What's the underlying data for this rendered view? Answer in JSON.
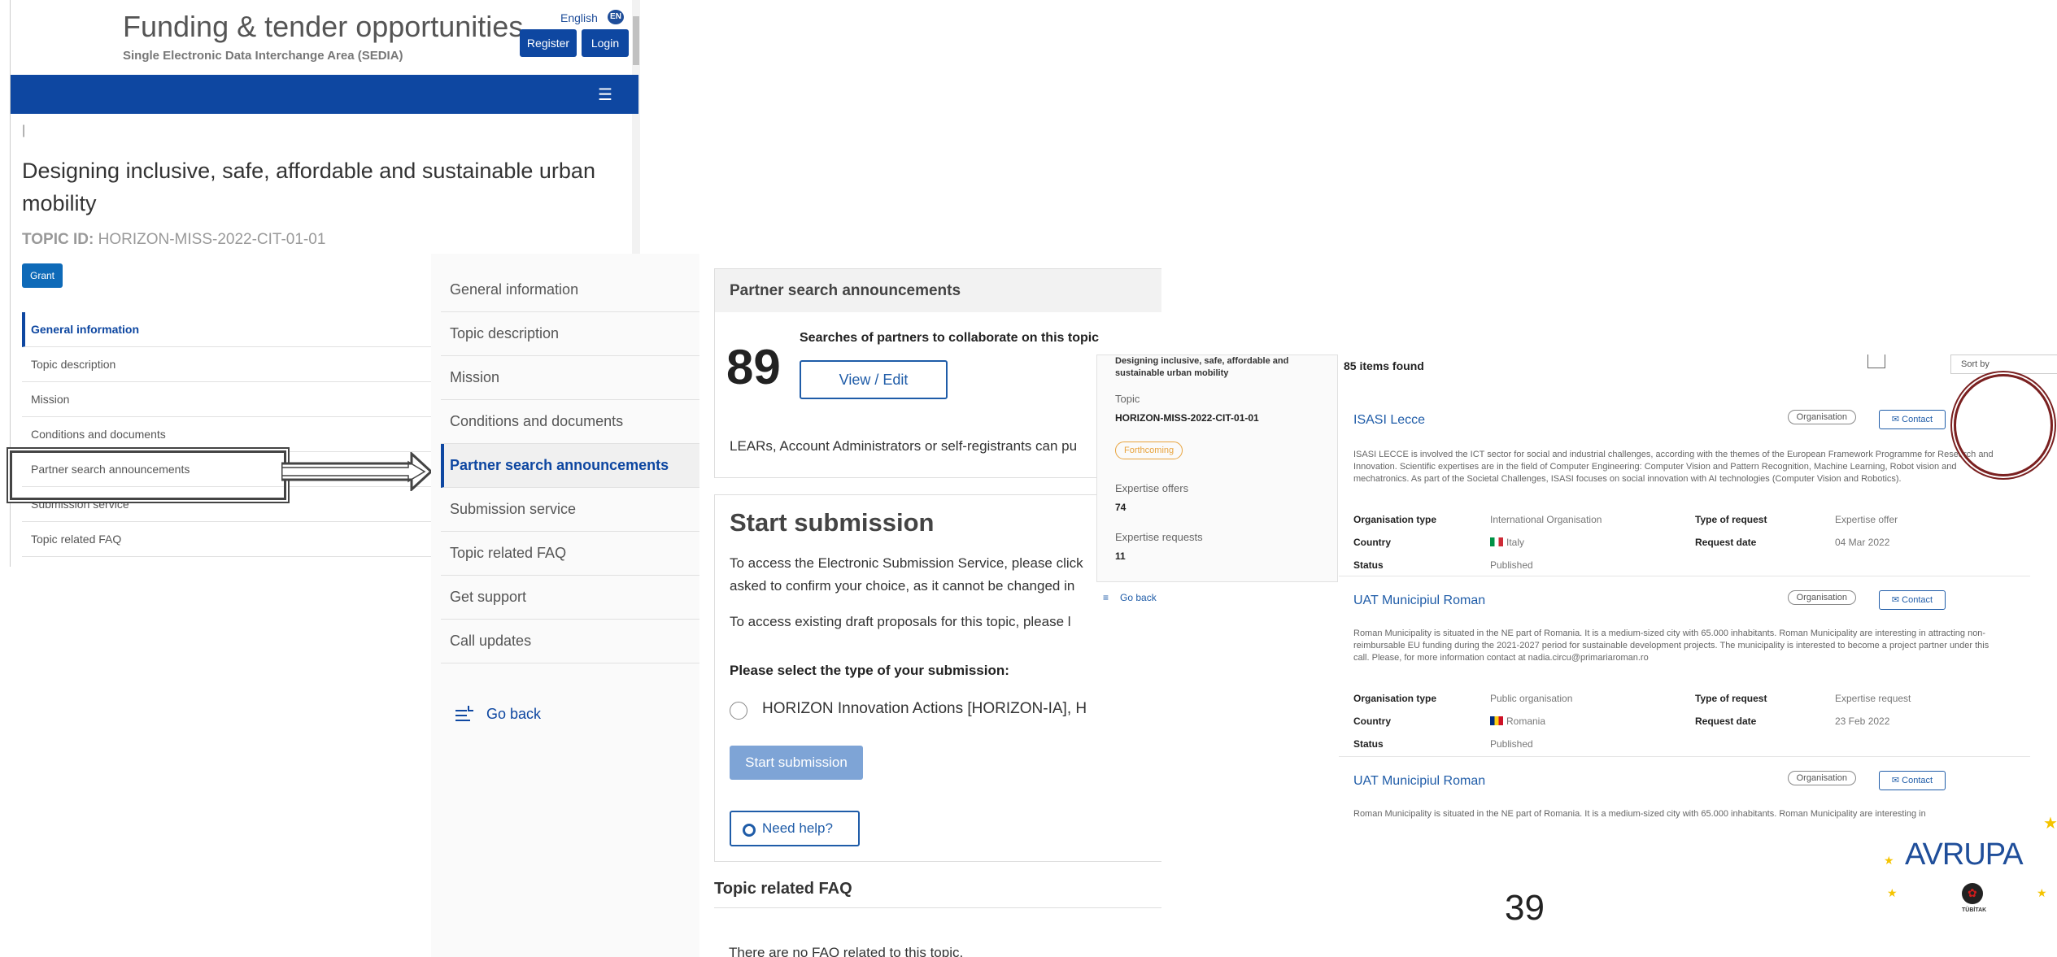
{
  "panel1": {
    "site_title": "Funding & tender opportunities",
    "site_subtitle": "Single Electronic Data Interchange Area (SEDIA)",
    "language": "English",
    "language_code": "EN",
    "register_label": "Register",
    "login_label": "Login",
    "menu_icon": "☰",
    "cursor_mark": "|",
    "topic_title": "Designing inclusive, safe, affordable and sustainable urban mobility",
    "topic_id_label": "TOPIC ID:",
    "topic_id": "HORIZON-MISS-2022-CIT-01-01",
    "grant_badge": "Grant",
    "nav": [
      "General information",
      "Topic description",
      "Mission",
      "Conditions and documents",
      "Partner search announcements",
      "Submission service",
      "Topic related FAQ"
    ]
  },
  "panel2": {
    "nav": [
      "General information",
      "Topic description",
      "Mission",
      "Conditions and documents",
      "Partner search announcements",
      "Submission service",
      "Topic related FAQ",
      "Get support",
      "Call updates"
    ],
    "go_back": "Go back",
    "partner_header": "Partner search announcements",
    "partner_count": "89",
    "partner_caption": "Searches of partners to collaborate on this topic",
    "view_edit": "View / Edit",
    "lears_text": "LEARs, Account Administrators or self-registrants can pu",
    "start_title": "Start submission",
    "start_text1": "To access the Electronic Submission Service, please click",
    "start_text2": "asked to confirm your choice, as it cannot be changed in",
    "start_text3": "To access existing draft proposals for this topic, please l",
    "select_type": "Please select the type of your submission:",
    "option1": "HORIZON Innovation Actions [HORIZON-IA], H",
    "start_button": "Start submission",
    "need_help": "Need help?",
    "faq_title": "Topic related FAQ",
    "faq_text": "There are no FAQ related to this topic."
  },
  "panel3": {
    "topic_title": "Designing inclusive, safe, affordable and sustainable urban mobility",
    "topic_label": "Topic",
    "topic_id": "HORIZON-MISS-2022-CIT-01-01",
    "status_badge": "Forthcoming",
    "offers_label": "Expertise offers",
    "offers_value": "74",
    "requests_label": "Expertise requests",
    "requests_value": "11",
    "go_back": "Go back",
    "items_found": "85 items found",
    "sort_by": "Sort by",
    "results": [
      {
        "title": "ISASI Lecce",
        "badge": "Organisation",
        "contact": "Contact",
        "desc": "ISASI LECCE is involved the ICT sector for social and industrial challenges, according with the themes of the European Framework Programme for Research and Innovation. Scientific expertises are in the field of Computer Engineering: Computer Vision and Pattern Recognition, Machine Learning, Robot vision and mechatronics. As part of the Societal Challenges, ISASI focuses on social innovation with AI technologies (Computer Vision and Robotics).",
        "org_type_label": "Organisation type",
        "org_type": "International Organisation",
        "req_type_label": "Type of request",
        "req_type": "Expertise offer",
        "country_label": "Country",
        "country": "Italy",
        "date_label": "Request date",
        "date": "04 Mar 2022",
        "status_label": "Status",
        "status": "Published"
      },
      {
        "title": "UAT Municipiul Roman",
        "badge": "Organisation",
        "contact": "Contact",
        "desc": "Roman Municipality is situated in the NE part of Romania. It is a medium-sized city with 65.000 inhabitants. Roman Municipality are interesting in attracting non-reimbursable EU funding during the 2021-2027 period for sustainable development projects. The municipality is interested to become a project partner under this call. Please, for more information contact at nadia.circu@primariaroman.ro",
        "org_type_label": "Organisation type",
        "org_type": "Public organisation",
        "req_type_label": "Type of request",
        "req_type": "Expertise request",
        "country_label": "Country",
        "country": "Romania",
        "date_label": "Request date",
        "date": "23 Feb 2022",
        "status_label": "Status",
        "status": "Published"
      },
      {
        "title": "UAT Municipiul Roman",
        "badge": "Organisation",
        "contact": "Contact",
        "desc": "Roman Municipality is situated in the NE part of Romania. It is a medium-sized city with 65.000 inhabitants. Roman Municipality are interesting in"
      }
    ]
  },
  "slide": {
    "page_number": "39",
    "logo_text": "AVRUPA",
    "logo_sub": "TÜBİTAK"
  },
  "colors": {
    "primary": "#0e47a1",
    "link": "#1f5ca8",
    "highlight": "#444444",
    "circle": "#7a2020"
  }
}
